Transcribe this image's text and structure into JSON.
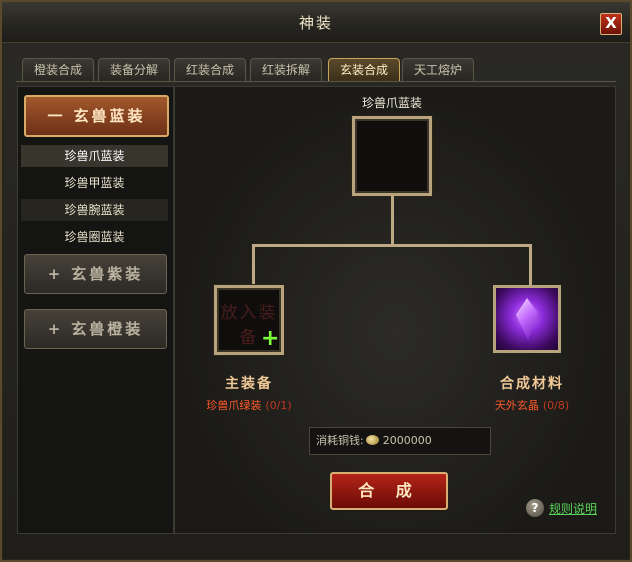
{
  "window": {
    "title": "神装",
    "close_label": "X"
  },
  "tabs": [
    {
      "label": "橙装合成"
    },
    {
      "label": "装备分解"
    },
    {
      "label": "红装合成"
    },
    {
      "label": "红装拆解"
    },
    {
      "label": "玄装合成"
    },
    {
      "label": "天工熔炉"
    }
  ],
  "active_tab": "玄装合成",
  "sidebar": {
    "categories": [
      {
        "label": "玄兽蓝装",
        "symbol": "一"
      },
      {
        "label": "玄兽紫装",
        "symbol": "+"
      },
      {
        "label": "玄兽橙装",
        "symbol": "+"
      }
    ],
    "sub_items": [
      {
        "label": "珍兽爪蓝装"
      },
      {
        "label": "珍兽甲蓝装"
      },
      {
        "label": "珍兽腕蓝装"
      },
      {
        "label": "珍兽圈蓝装"
      }
    ]
  },
  "result": {
    "label": "珍兽爪蓝装"
  },
  "main_slot": {
    "title": "主装备",
    "item": "珍兽爪绿装",
    "count": "(0/1)",
    "placeholder": "放入装备"
  },
  "material_slot": {
    "title": "合成材料",
    "item": "天外玄晶",
    "count": "(0/8)"
  },
  "cost": {
    "label": "消耗铜钱:",
    "value": "2000000"
  },
  "confirm_label": "合 成",
  "help": {
    "icon": "?",
    "label": "规则说明"
  },
  "colors": {
    "accent_gold": "#b8a47c",
    "confirm_red": "#b42418",
    "item_orange": "#ff5a2a",
    "help_green": "#5ad45a"
  }
}
